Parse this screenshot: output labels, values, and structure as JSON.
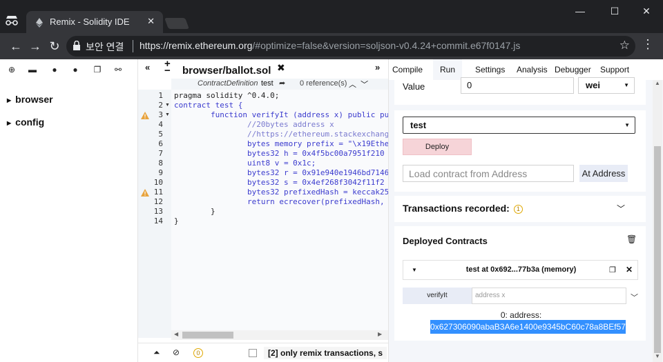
{
  "browser": {
    "tab_title": "Remix - Solidity IDE",
    "secure_label": "보안 연결",
    "url_host": "https://remix.ethereum.org",
    "url_rest": "/#optimize=false&version=soljson-v0.4.24+commit.e67f0147.js"
  },
  "explorer": {
    "folders": [
      "browser",
      "config"
    ]
  },
  "editor": {
    "file_tab": "browser/ballot.sol",
    "context": {
      "type": "ContractDefinition",
      "name": "test",
      "references": "0 reference(s)"
    },
    "line_numbers": [
      "1",
      "2",
      "3",
      "4",
      "5",
      "6",
      "7",
      "8",
      "9",
      "10",
      "11",
      "12",
      "13",
      "14"
    ],
    "code": [
      "pragma solidity ^0.4.0;",
      "contract test {",
      "        function verifyIt (address x) public pu",
      "                //20bytes address x",
      "                //https://ethereum.stackexchang",
      "                bytes memory prefix = \"\\x19Ethe",
      "                bytes32 h = 0x4f5bc00a7951f210",
      "                uint8 v = 0x1c;",
      "                bytes32 r = 0x91e940e1946bd7146",
      "                bytes32 s = 0x4ef268f3042f11f2",
      "                bytes32 prefixedHash = keccak25",
      "                return ecrecover(prefixedHash,",
      "        }",
      "}"
    ],
    "terminal_text": "[2] only remix transactions, s",
    "terminal_badge": "0"
  },
  "run_panel": {
    "tabs": [
      "Compile",
      "Run",
      "Settings",
      "Analysis",
      "Debugger",
      "Support"
    ],
    "active_tab": "Run",
    "value_label": "Value",
    "value": "0",
    "unit": "wei",
    "contract_selected": "test",
    "deploy_label": "Deploy",
    "load_placeholder": "Load contract from Address",
    "at_address_label": "At Address",
    "transactions_label": "Transactions recorded:",
    "transactions_count": "1",
    "deployed_label": "Deployed Contracts",
    "instance_title": "test at 0x692...77b3a (memory)",
    "function_label": "verifyIt",
    "function_placeholder": "address x",
    "output_label": "0: address:",
    "output_value": "0x627306090abaB3A6e1400e9345bC60c78a8BEf57"
  }
}
